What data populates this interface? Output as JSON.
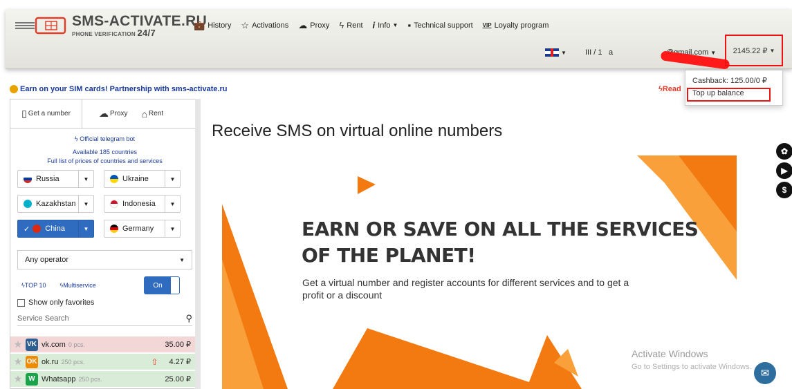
{
  "header": {
    "logo_title": "SMS-ACTIVATE.RU",
    "logo_sub": "PHONE VERIFICATION",
    "logo_sub_hours": "24/7",
    "menu": [
      {
        "label": "History",
        "icon": "briefcase-icon"
      },
      {
        "label": "Activations",
        "icon": "star-icon"
      },
      {
        "label": "Proxy",
        "icon": "cloud-icon"
      },
      {
        "label": "Rent",
        "icon": "lightning-icon"
      },
      {
        "label": "Info",
        "icon": "info-icon"
      },
      {
        "label": "Technical support",
        "icon": "chat-icon"
      },
      {
        "label": "Loyalty program",
        "icon": "vip-icon"
      }
    ],
    "vip_badge": "VIP",
    "user_count": "III / 1",
    "email_visible": "a",
    "email_suffix": "@gmail.com",
    "balance": "2145.22 ₽"
  },
  "balance_menu": {
    "cashback": "Cashback: 125.00/0 ₽",
    "top_up": "Top up balance"
  },
  "banner": {
    "partner_text": "Earn on your SIM cards! Partnership with sms-activate.ru",
    "read_more": "Read"
  },
  "left_panel": {
    "tabs": [
      "Get a number",
      "Proxy",
      "Rent"
    ],
    "telegram_bot": "Official telegram bot",
    "available_prefix": "Available ",
    "available_count": "185",
    "available_suffix": " countries",
    "full_list": "Full list of prices of countries and services",
    "countries": [
      {
        "name": "Russia",
        "color": "#d52b1e",
        "active": false
      },
      {
        "name": "Ukraine",
        "color": "#ffd500",
        "active": false
      },
      {
        "name": "Kazakhstan",
        "color": "#00afca",
        "active": false
      },
      {
        "name": "Indonesia",
        "color": "#ce1126",
        "active": false
      },
      {
        "name": "China",
        "color": "#de2910",
        "active": true
      },
      {
        "name": "Germany",
        "color": "#000000",
        "active": false
      }
    ],
    "operator": "Any operator",
    "top10": "TOP 10",
    "multiservice": "Multiservice",
    "toggle_label": "On",
    "favorites": "Show only favorites",
    "search_placeholder": "Service Search",
    "services": [
      {
        "name": "vk.com",
        "pcs": "0 pcs.",
        "price": "35.00 ₽",
        "bg": "#f3d6d6",
        "icon_bg": "#2d5f93",
        "icon_text": "VK"
      },
      {
        "name": "ok.ru",
        "pcs": "250 pcs.",
        "price": "4.27 ₽",
        "bg": "#d9ecd7",
        "icon_bg": "#f08a00",
        "icon_text": "OK"
      },
      {
        "name": "Whatsapp",
        "pcs": "250 pcs.",
        "price": "25.00 ₽",
        "bg": "#d9ecd7",
        "icon_bg": "#1aa34a",
        "icon_text": "W"
      }
    ]
  },
  "main": {
    "title": "Receive SMS on virtual online numbers",
    "promo_heading_1": "EARN OR SAVE ON ALL THE SERVICES",
    "promo_heading_2": "OF THE PLANET!",
    "promo_text": "Get a virtual number and register accounts for different services and to get a profit or a discount"
  },
  "windows_notice": {
    "title": "Activate Windows",
    "sub": "Go to Settings to activate Windows."
  },
  "colors": {
    "accent": "#2f6bbf",
    "highlight": "#e11111",
    "orange": "#f27a10"
  }
}
